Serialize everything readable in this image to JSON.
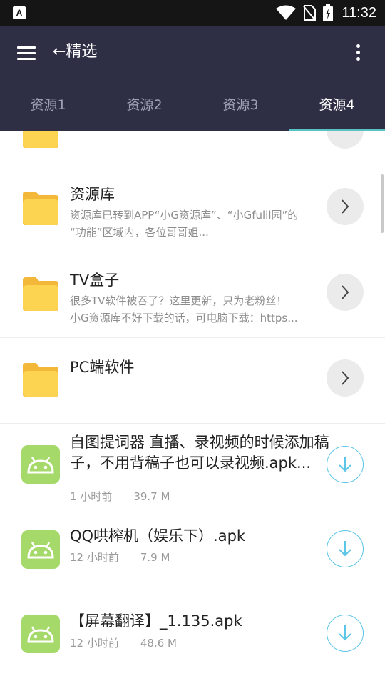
{
  "status_bar": {
    "time": "11:32",
    "left_icon_glyph": "A"
  },
  "app_bar": {
    "title": "←精选"
  },
  "tabs": [
    {
      "label": "资源1",
      "active": false
    },
    {
      "label": "资源2",
      "active": false
    },
    {
      "label": "资源3",
      "active": false
    },
    {
      "label": "资源4",
      "active": true
    }
  ],
  "folders": [
    {
      "title": "资源库",
      "desc_line1": "资源库已转到APP“小G资源库”、“小Gfulil园”的",
      "desc_line2": "“功能”区域内，各位哥哥姐..."
    },
    {
      "title": "TV盒子",
      "desc_line1": "很多TV软件被吞了？这里更新，只为老粉丝！",
      "desc_line2": "小G资源库不好下载的话，可电脑下载：https..."
    },
    {
      "title": "PC端软件",
      "desc_line1": "",
      "desc_line2": ""
    }
  ],
  "apks": [
    {
      "title": "自图提词器 直播、录视频的时候添加稿子，不用背稿子也可以录视频.apk...",
      "time": "1 小时前",
      "size": "39.7 M"
    },
    {
      "title": "QQ哄榨机（娱乐下）.apk",
      "time": "12 小时前",
      "size": "7.9 M"
    },
    {
      "title": "【屏幕翻译】_1.135.apk",
      "time": "12 小时前",
      "size": "48.6 M"
    }
  ],
  "colors": {
    "appbar": "#2e2f45",
    "tab_indicator": "#58c3c3",
    "folder": "#fdd452",
    "apk_bg": "#a5d96a",
    "download_ring": "#5cc6e6"
  }
}
